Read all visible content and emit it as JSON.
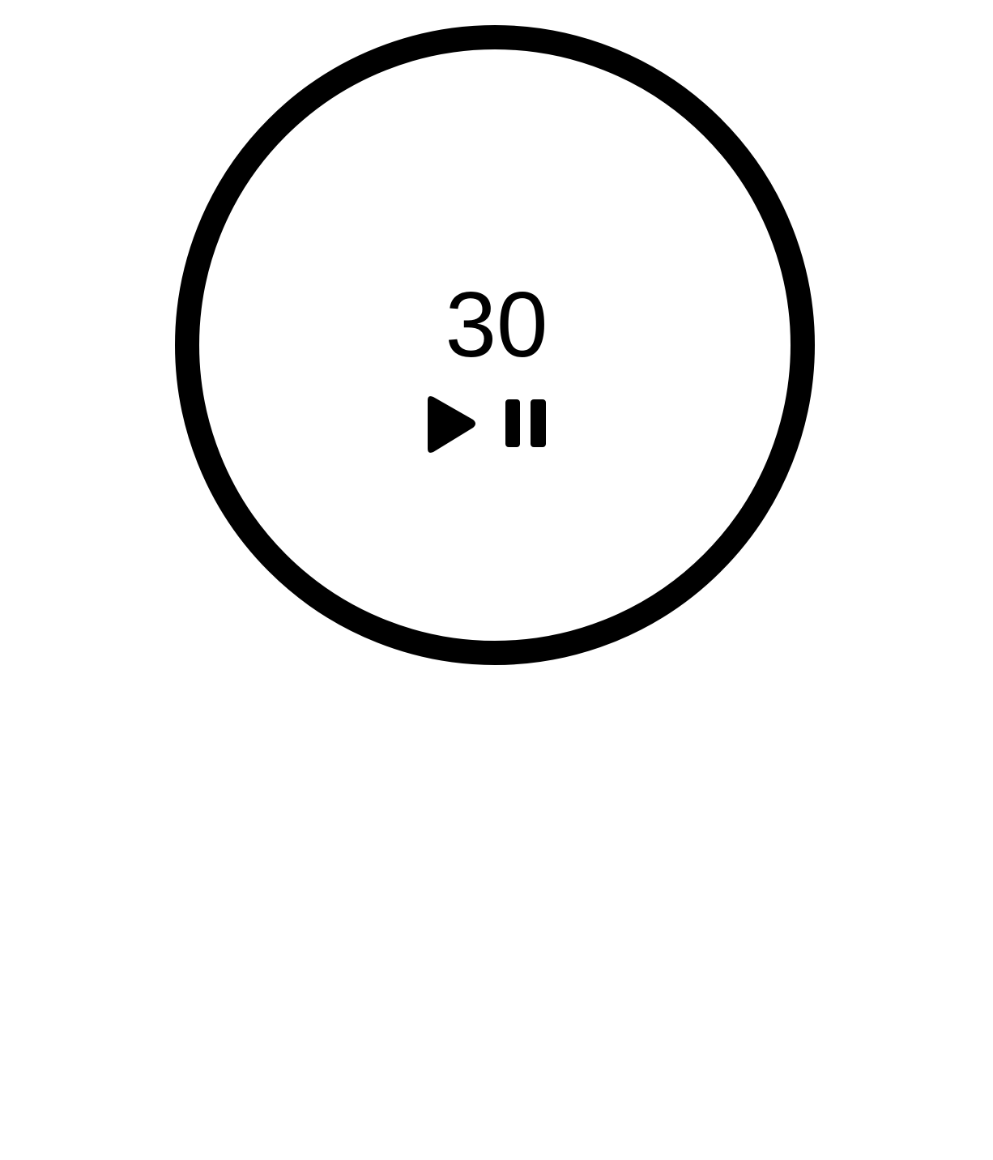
{
  "timer": {
    "value": "30"
  },
  "controls": {
    "play_icon": "play-icon",
    "pause_icon": "pause-icon"
  },
  "colors": {
    "ring": "#000000",
    "text": "#000000",
    "background": "#ffffff"
  }
}
